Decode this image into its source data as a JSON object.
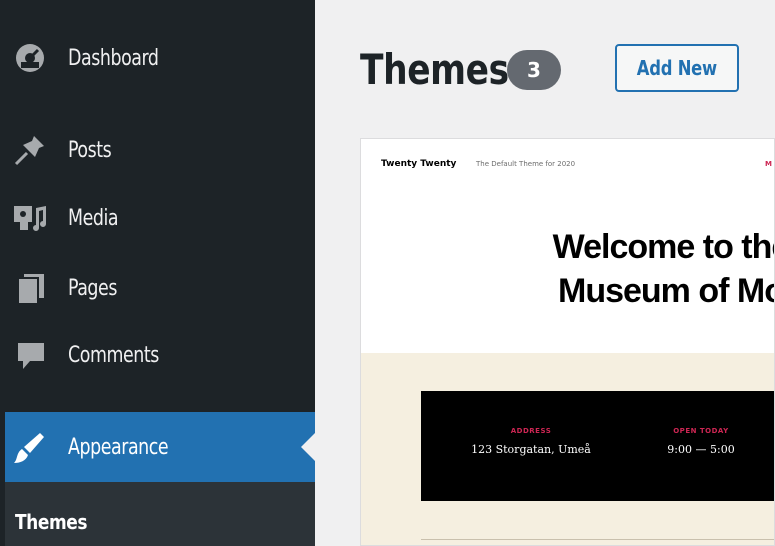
{
  "sidebar": {
    "items": [
      {
        "label": "Dashboard",
        "icon": "dashboard-icon"
      },
      {
        "label": "Posts",
        "icon": "pin-icon"
      },
      {
        "label": "Media",
        "icon": "media-icon"
      },
      {
        "label": "Pages",
        "icon": "pages-icon"
      },
      {
        "label": "Comments",
        "icon": "comment-icon"
      },
      {
        "label": "Appearance",
        "icon": "paintbrush-icon",
        "active": true
      }
    ],
    "submenu": {
      "items": [
        {
          "label": "Themes",
          "active": true
        }
      ]
    }
  },
  "main": {
    "title": "Themes",
    "count": "3",
    "add_new_label": "Add New"
  },
  "theme_card": {
    "site_title": "Twenty Twenty",
    "tagline": "The Default Theme for 2020",
    "menu_hint": "M",
    "hero_line1": "Welcome to the",
    "hero_line2": "Museum of Mo",
    "address_label": "ADDRESS",
    "address_value": "123 Storgatan, Umeå",
    "hours_label": "OPEN TODAY",
    "hours_value": "9:00 — 5:00"
  },
  "colors": {
    "sidebar_bg": "#1d2327",
    "active_bg": "#2271b1",
    "accent": "#cd2653",
    "page_bg": "#f0f0f1"
  }
}
